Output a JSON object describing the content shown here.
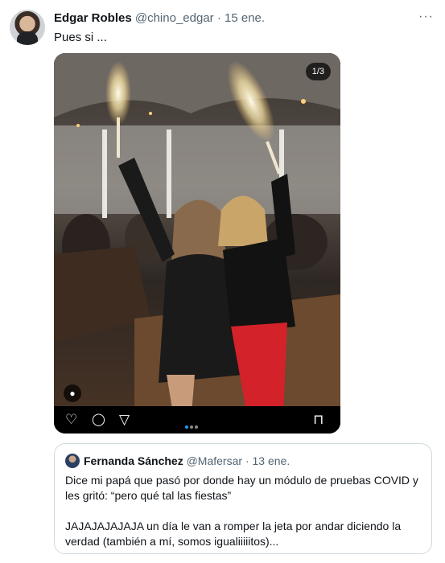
{
  "tweet": {
    "author_name": "Edgar Robles",
    "handle": "@chino_edgar",
    "separator": "·",
    "date": "15 ene.",
    "more": "···",
    "text": "Pues si ...",
    "media": {
      "counter": "1/3",
      "person_tag_icon": "person-icon",
      "carousel_dots": 3,
      "active_dot": 1
    },
    "actions": {
      "like": "♡",
      "reply": "◯",
      "share": "▽",
      "bookmark": "⊓"
    }
  },
  "quote": {
    "author_name": "Fernanda Sánchez",
    "handle": "@Mafersar",
    "separator": "·",
    "date": "13 ene.",
    "paragraph1": "Dice mi papá que pasó por donde hay un módulo de pruebas COVID y les gritó: “pero qué tal las fiestas”",
    "paragraph2": "JAJAJAJAJAJA un día le van a romper la jeta por andar diciendo la verdad (también a mí, somos igualiiiiitos)..."
  },
  "colors": {
    "text": "#0f1419",
    "secondary": "#536471",
    "accent": "#1d9bf0",
    "border": "#cfd9de"
  }
}
